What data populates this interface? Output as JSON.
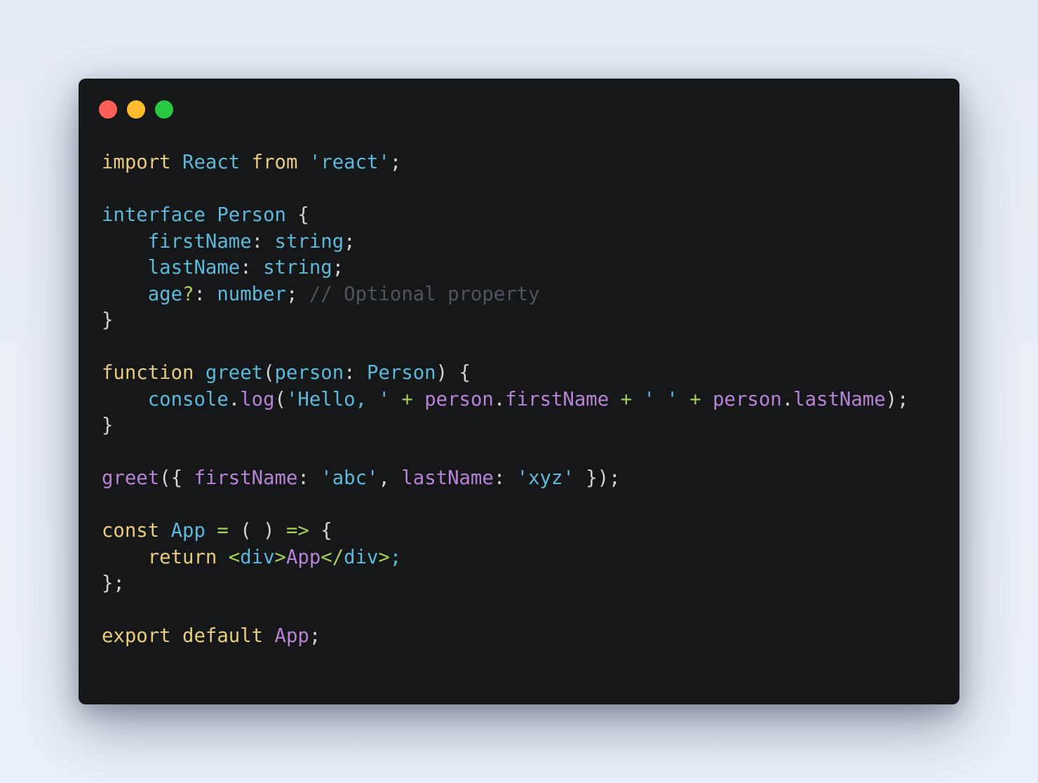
{
  "window": {
    "traffic_lights": [
      {
        "name": "close",
        "color": "#ff5f57"
      },
      {
        "name": "minimize",
        "color": "#febc2e"
      },
      {
        "name": "maximize",
        "color": "#28c840"
      }
    ]
  },
  "code": {
    "language": "typescript",
    "lines": [
      [
        [
          "kw",
          "import"
        ],
        [
          "pun",
          " "
        ],
        [
          "ty",
          "React"
        ],
        [
          "pun",
          " "
        ],
        [
          "kw",
          "from"
        ],
        [
          "pun",
          " "
        ],
        [
          "str",
          "'react'"
        ],
        [
          "pun",
          ";"
        ]
      ],
      [],
      [
        [
          "ty",
          "interface"
        ],
        [
          "pun",
          " "
        ],
        [
          "ty",
          "Person"
        ],
        [
          "pun",
          " {"
        ]
      ],
      [
        [
          "pun",
          "    "
        ],
        [
          "ty",
          "firstName"
        ],
        [
          "pun",
          ": "
        ],
        [
          "ty",
          "string"
        ],
        [
          "pun",
          ";"
        ]
      ],
      [
        [
          "pun",
          "    "
        ],
        [
          "ty",
          "lastName"
        ],
        [
          "pun",
          ": "
        ],
        [
          "ty",
          "string"
        ],
        [
          "pun",
          ";"
        ]
      ],
      [
        [
          "pun",
          "    "
        ],
        [
          "ty",
          "age"
        ],
        [
          "op",
          "?"
        ],
        [
          "pun",
          ": "
        ],
        [
          "ty",
          "number"
        ],
        [
          "pun",
          "; "
        ],
        [
          "com",
          "// Optional property"
        ]
      ],
      [
        [
          "pun",
          "}"
        ]
      ],
      [],
      [
        [
          "kw",
          "function"
        ],
        [
          "pun",
          " "
        ],
        [
          "ty",
          "greet"
        ],
        [
          "pun",
          "("
        ],
        [
          "ty",
          "person"
        ],
        [
          "pun",
          ": "
        ],
        [
          "ty",
          "Person"
        ],
        [
          "pun",
          ") {"
        ]
      ],
      [
        [
          "pun",
          "    "
        ],
        [
          "ty",
          "console"
        ],
        [
          "pun",
          "."
        ],
        [
          "prop",
          "log"
        ],
        [
          "pun",
          "("
        ],
        [
          "str",
          "'Hello, '"
        ],
        [
          "pun",
          " "
        ],
        [
          "op",
          "+"
        ],
        [
          "pun",
          " "
        ],
        [
          "prop",
          "person"
        ],
        [
          "pun",
          "."
        ],
        [
          "prop",
          "firstName"
        ],
        [
          "pun",
          " "
        ],
        [
          "op",
          "+"
        ],
        [
          "pun",
          " "
        ],
        [
          "str",
          "' '"
        ],
        [
          "pun",
          " "
        ],
        [
          "op",
          "+"
        ],
        [
          "pun",
          " "
        ],
        [
          "prop",
          "person"
        ],
        [
          "pun",
          "."
        ],
        [
          "prop",
          "lastName"
        ],
        [
          "pun",
          ");"
        ]
      ],
      [
        [
          "pun",
          "}"
        ]
      ],
      [],
      [
        [
          "prop",
          "greet"
        ],
        [
          "pun",
          "({ "
        ],
        [
          "prop",
          "firstName"
        ],
        [
          "pun",
          ": "
        ],
        [
          "str",
          "'abc'"
        ],
        [
          "pun",
          ", "
        ],
        [
          "prop",
          "lastName"
        ],
        [
          "pun",
          ": "
        ],
        [
          "str",
          "'xyz'"
        ],
        [
          "pun",
          " });"
        ]
      ],
      [],
      [
        [
          "kw",
          "const"
        ],
        [
          "pun",
          " "
        ],
        [
          "ty",
          "App"
        ],
        [
          "pun",
          " "
        ],
        [
          "op",
          "="
        ],
        [
          "pun",
          " ( ) "
        ],
        [
          "op",
          "=>"
        ],
        [
          "pun",
          " {"
        ]
      ],
      [
        [
          "pun",
          "    "
        ],
        [
          "kw",
          "return"
        ],
        [
          "pun",
          " "
        ],
        [
          "op",
          "<"
        ],
        [
          "ty",
          "div"
        ],
        [
          "op",
          ">"
        ],
        [
          "prop",
          "App"
        ],
        [
          "op",
          "</"
        ],
        [
          "ty",
          "div"
        ],
        [
          "op",
          ">"
        ],
        [
          "ty",
          ";"
        ]
      ],
      [
        [
          "pun",
          "};"
        ]
      ],
      [],
      [
        [
          "kw",
          "export"
        ],
        [
          "pun",
          " "
        ],
        [
          "kw",
          "default"
        ],
        [
          "pun",
          " "
        ],
        [
          "prop",
          "App"
        ],
        [
          "pun",
          ";"
        ]
      ]
    ]
  }
}
